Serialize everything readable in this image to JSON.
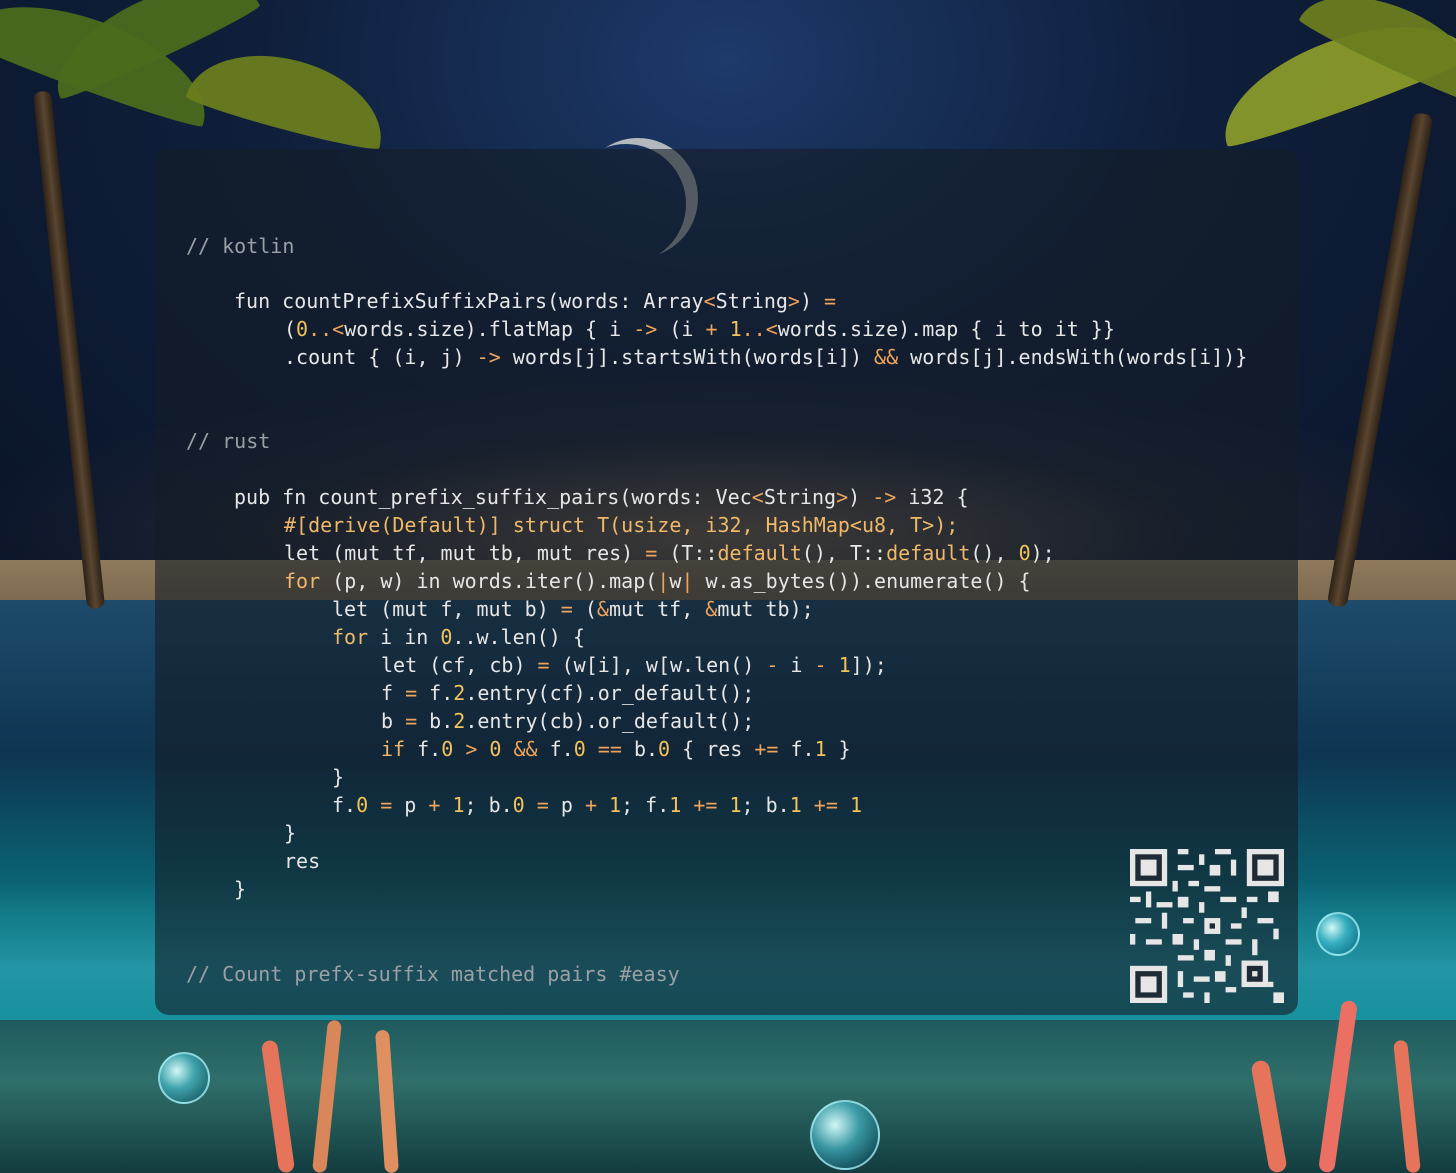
{
  "code": {
    "comment_kotlin": "// kotlin",
    "comment_rust": "// rust",
    "comment_footer": "// Count prefx-suffix matched pairs #easy",
    "kotlin_lines": [
      [
        {
          "t": "fun countPrefixSuffixPairs(words: Array",
          "c": ""
        },
        {
          "t": "<",
          "c": "op"
        },
        {
          "t": "String",
          "c": ""
        },
        {
          "t": ">",
          "c": "op"
        },
        {
          "t": ") ",
          "c": ""
        },
        {
          "t": "=",
          "c": "op"
        }
      ],
      [
        {
          "t": "(",
          "c": ""
        },
        {
          "t": "0",
          "c": "num"
        },
        {
          "t": "..<",
          "c": "op"
        },
        {
          "t": "words.size).flatMap { i ",
          "c": ""
        },
        {
          "t": "->",
          "c": "op"
        },
        {
          "t": " (i ",
          "c": ""
        },
        {
          "t": "+",
          "c": "op"
        },
        {
          "t": " ",
          "c": ""
        },
        {
          "t": "1",
          "c": "num"
        },
        {
          "t": "..<",
          "c": "op"
        },
        {
          "t": "words.size).map { i to it }}",
          "c": ""
        }
      ],
      [
        {
          "t": ".count { (i, j) ",
          "c": ""
        },
        {
          "t": "->",
          "c": "op"
        },
        {
          "t": " words[j].startsWith(words[i]) ",
          "c": ""
        },
        {
          "t": "&&",
          "c": "op"
        },
        {
          "t": " words[j].endsWith(words[i])}",
          "c": ""
        }
      ]
    ],
    "rust_lines": [
      [
        {
          "t": "pub fn count_prefix_suffix_pairs(words: Vec",
          "c": ""
        },
        {
          "t": "<",
          "c": "op"
        },
        {
          "t": "String",
          "c": ""
        },
        {
          "t": ">",
          "c": "op"
        },
        {
          "t": ") ",
          "c": ""
        },
        {
          "t": "->",
          "c": "op"
        },
        {
          "t": " i32 {",
          "c": ""
        }
      ],
      [
        {
          "t": "#[derive(Default)] struct T(usize, i32, HashMap<u8, T>);",
          "c": "kw"
        }
      ],
      [
        {
          "t": "let (mut tf, mut tb, mut res) ",
          "c": ""
        },
        {
          "t": "=",
          "c": "op"
        },
        {
          "t": " (T::",
          "c": ""
        },
        {
          "t": "default",
          "c": "kw"
        },
        {
          "t": "(), T::",
          "c": ""
        },
        {
          "t": "default",
          "c": "kw"
        },
        {
          "t": "(), ",
          "c": ""
        },
        {
          "t": "0",
          "c": "num"
        },
        {
          "t": ");",
          "c": ""
        }
      ],
      [
        {
          "t": "for",
          "c": "kw"
        },
        {
          "t": " (p, w) in words.iter().map(",
          "c": ""
        },
        {
          "t": "|",
          "c": "op"
        },
        {
          "t": "w",
          "c": ""
        },
        {
          "t": "|",
          "c": "op"
        },
        {
          "t": " w.as_bytes()).enumerate() {",
          "c": ""
        }
      ],
      [
        {
          "t": "let (mut f, mut b) ",
          "c": ""
        },
        {
          "t": "=",
          "c": "op"
        },
        {
          "t": " (",
          "c": ""
        },
        {
          "t": "&",
          "c": "op"
        },
        {
          "t": "mut tf, ",
          "c": ""
        },
        {
          "t": "&",
          "c": "op"
        },
        {
          "t": "mut tb);",
          "c": ""
        }
      ],
      [
        {
          "t": "for",
          "c": "kw"
        },
        {
          "t": " i in ",
          "c": ""
        },
        {
          "t": "0",
          "c": "num"
        },
        {
          "t": "..w.len() {",
          "c": ""
        }
      ],
      [
        {
          "t": "let (cf, cb) ",
          "c": ""
        },
        {
          "t": "=",
          "c": "op"
        },
        {
          "t": " (w[i], w[w.len() ",
          "c": ""
        },
        {
          "t": "-",
          "c": "op"
        },
        {
          "t": " i ",
          "c": ""
        },
        {
          "t": "-",
          "c": "op"
        },
        {
          "t": " ",
          "c": ""
        },
        {
          "t": "1",
          "c": "num"
        },
        {
          "t": "]);",
          "c": ""
        }
      ],
      [
        {
          "t": "f ",
          "c": ""
        },
        {
          "t": "=",
          "c": "op"
        },
        {
          "t": " f.",
          "c": ""
        },
        {
          "t": "2",
          "c": "num"
        },
        {
          "t": ".entry(cf).or_default();",
          "c": ""
        }
      ],
      [
        {
          "t": "b ",
          "c": ""
        },
        {
          "t": "=",
          "c": "op"
        },
        {
          "t": " b.",
          "c": ""
        },
        {
          "t": "2",
          "c": "num"
        },
        {
          "t": ".entry(cb).or_default();",
          "c": ""
        }
      ],
      [
        {
          "t": "if",
          "c": "kw"
        },
        {
          "t": " f.",
          "c": ""
        },
        {
          "t": "0",
          "c": "num"
        },
        {
          "t": " ",
          "c": ""
        },
        {
          "t": ">",
          "c": "op"
        },
        {
          "t": " ",
          "c": ""
        },
        {
          "t": "0",
          "c": "num"
        },
        {
          "t": " ",
          "c": ""
        },
        {
          "t": "&&",
          "c": "op"
        },
        {
          "t": " f.",
          "c": ""
        },
        {
          "t": "0",
          "c": "num"
        },
        {
          "t": " ",
          "c": ""
        },
        {
          "t": "==",
          "c": "op"
        },
        {
          "t": " b.",
          "c": ""
        },
        {
          "t": "0",
          "c": "num"
        },
        {
          "t": " { res ",
          "c": ""
        },
        {
          "t": "+=",
          "c": "op"
        },
        {
          "t": " f.",
          "c": ""
        },
        {
          "t": "1",
          "c": "num"
        },
        {
          "t": " }",
          "c": ""
        }
      ],
      [
        {
          "t": "}",
          "c": ""
        }
      ],
      [
        {
          "t": "f.",
          "c": ""
        },
        {
          "t": "0",
          "c": "num"
        },
        {
          "t": " ",
          "c": ""
        },
        {
          "t": "=",
          "c": "op"
        },
        {
          "t": " p ",
          "c": ""
        },
        {
          "t": "+",
          "c": "op"
        },
        {
          "t": " ",
          "c": ""
        },
        {
          "t": "1",
          "c": "num"
        },
        {
          "t": "; b.",
          "c": ""
        },
        {
          "t": "0",
          "c": "num"
        },
        {
          "t": " ",
          "c": ""
        },
        {
          "t": "=",
          "c": "op"
        },
        {
          "t": " p ",
          "c": ""
        },
        {
          "t": "+",
          "c": "op"
        },
        {
          "t": " ",
          "c": ""
        },
        {
          "t": "1",
          "c": "num"
        },
        {
          "t": "; f.",
          "c": ""
        },
        {
          "t": "1",
          "c": "num"
        },
        {
          "t": " ",
          "c": ""
        },
        {
          "t": "+=",
          "c": "op"
        },
        {
          "t": " ",
          "c": ""
        },
        {
          "t": "1",
          "c": "num"
        },
        {
          "t": "; b.",
          "c": ""
        },
        {
          "t": "1",
          "c": "num"
        },
        {
          "t": " ",
          "c": ""
        },
        {
          "t": "+=",
          "c": "op"
        },
        {
          "t": " ",
          "c": ""
        },
        {
          "t": "1",
          "c": "num"
        }
      ],
      [
        {
          "t": "}",
          "c": ""
        }
      ],
      [
        {
          "t": "res",
          "c": ""
        }
      ],
      [
        {
          "t": "}",
          "c": ""
        }
      ]
    ]
  },
  "colors": {
    "card_bg": "rgba(20, 28, 38, 0.60)",
    "comment": "#9aa0a6",
    "keyword": "#f0b869",
    "number": "#f3c35b",
    "operator": "#f0a35a",
    "text": "#e6e6e6"
  },
  "qr_icon": "qr-code-icon",
  "background": "tropical-night-beach-underwater-scene"
}
